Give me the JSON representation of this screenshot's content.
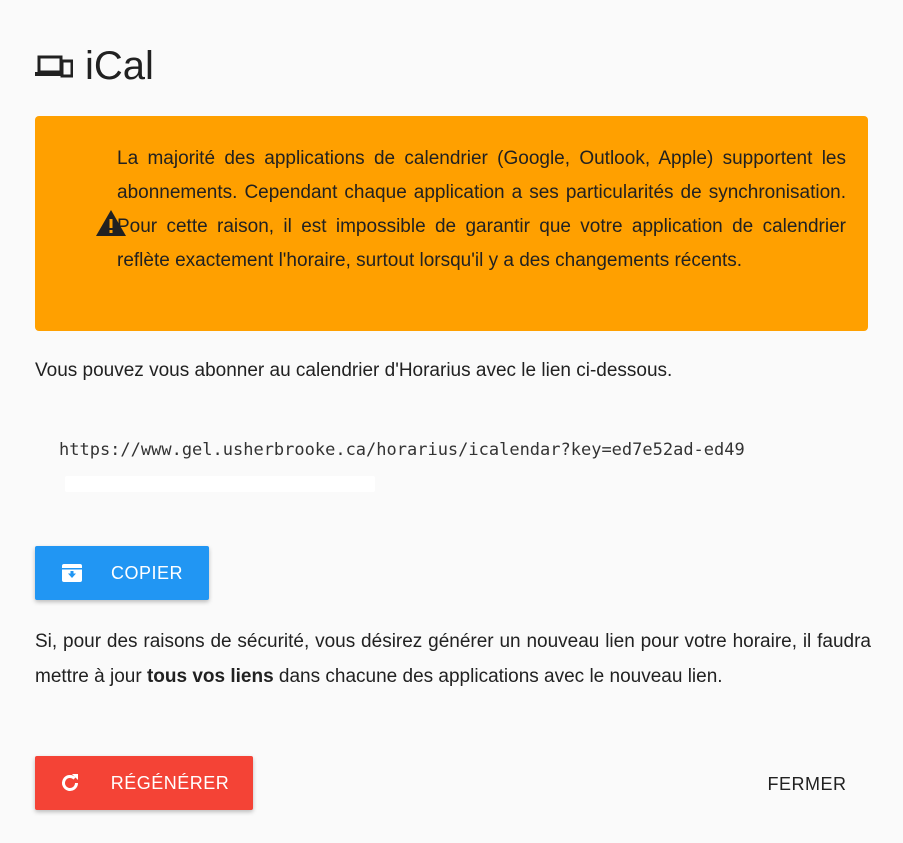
{
  "dialog": {
    "title": "iCal",
    "title_icon": "devices-icon",
    "warning": {
      "icon": "warning-icon",
      "text": "La majorité des applications de calendrier (Google, Outlook, Apple) supportent les abonnements. Cependant chaque application a ses particularités de synchronisation. Pour cette raison, il est impossible de garantir que votre application de calendrier reflète exactement l'horaire, surtout lorsqu'il y a des changements récents.",
      "background_color": "#ffa000"
    },
    "intro_text": "Vous pouvez vous abonner au calendrier d'Horarius avec le lien ci-dessous.",
    "link_text": "https://www.gel.usherbrooke.ca/horarius/icalendar?key=ed7e52ad-ed49",
    "copy_button": {
      "label": "COPIER",
      "icon": "copy-archive-icon",
      "color": "#2196f3"
    },
    "security_text": {
      "before": "Si, pour des raisons de sécurité, vous désirez générer un nouveau lien pour votre horaire, il faudra mettre à jour ",
      "bold": "tous vos liens",
      "after": " dans chacune des applications avec le nouveau lien."
    },
    "regenerate_button": {
      "label": "RÉGÉNÉRER",
      "icon": "refresh-icon",
      "color": "#f44336"
    },
    "close_button": {
      "label": "FERMER"
    }
  }
}
